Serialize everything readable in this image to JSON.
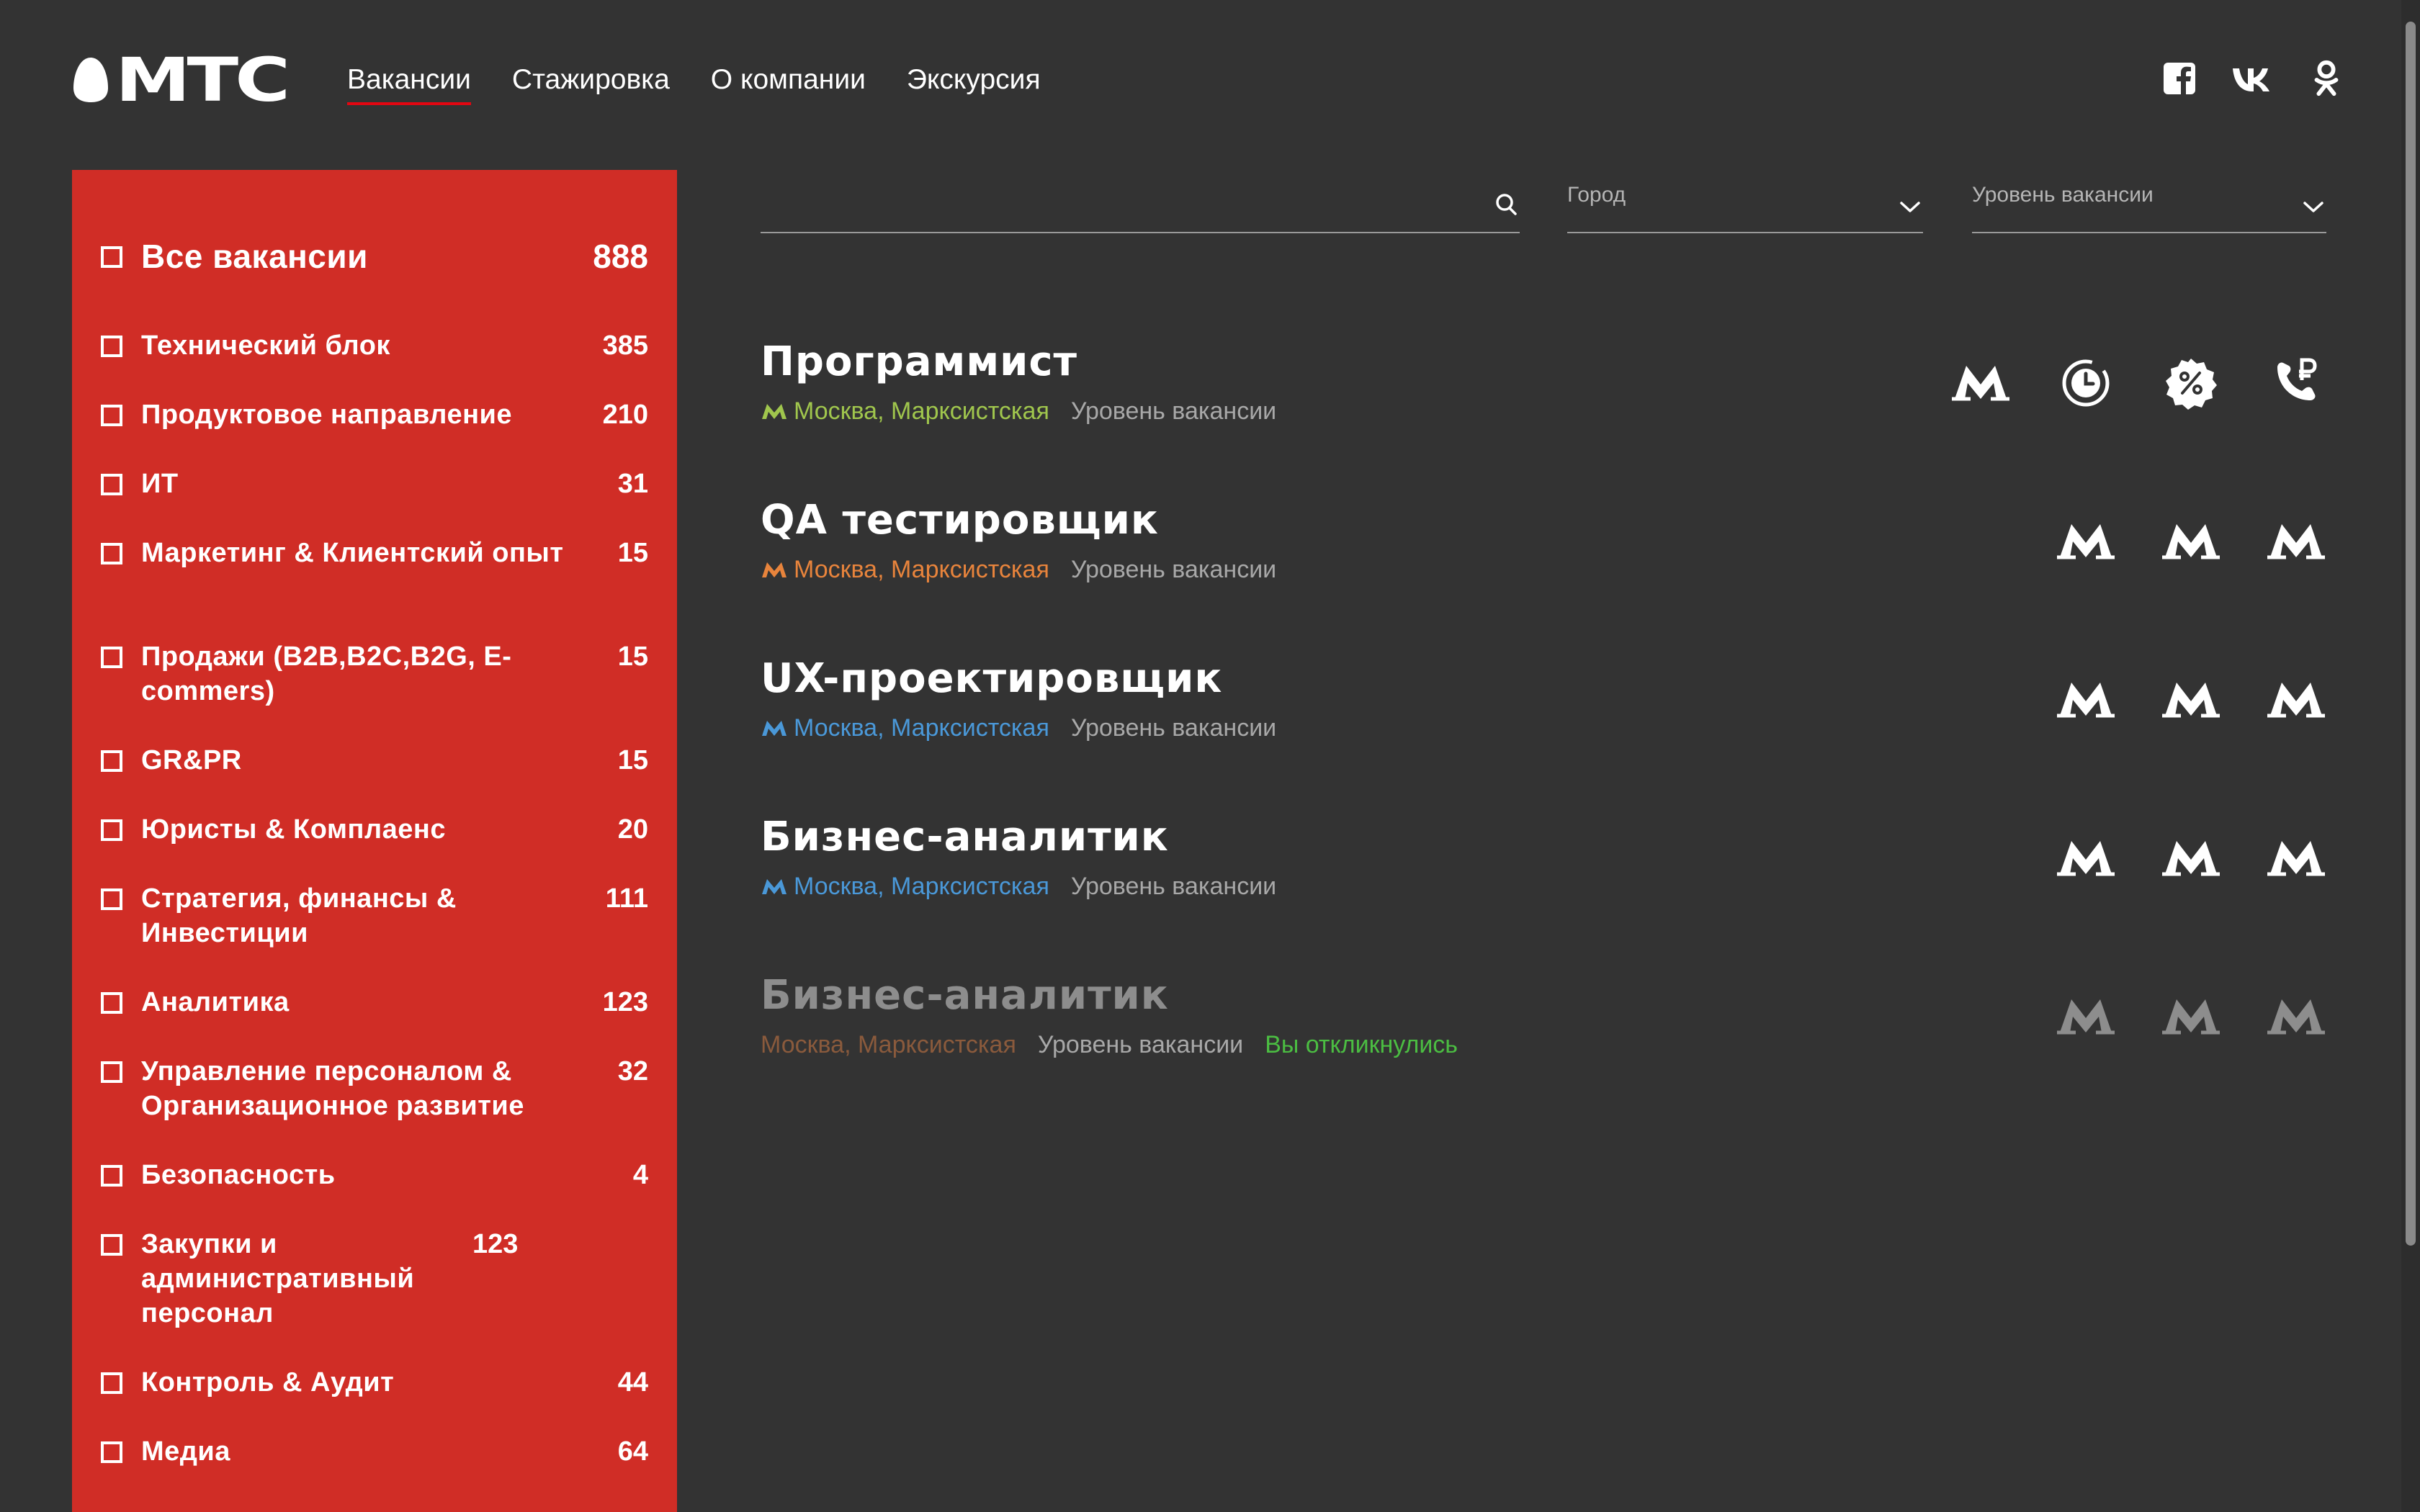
{
  "header": {
    "logo_text": "МТС",
    "nav": [
      {
        "label": "Вакансии",
        "active": true
      },
      {
        "label": "Стажировка",
        "active": false
      },
      {
        "label": "О компании",
        "active": false
      },
      {
        "label": "Экскурсия",
        "active": false
      }
    ],
    "social": [
      "facebook-icon",
      "vk-icon",
      "odnoklassniki-icon"
    ]
  },
  "sidebar": {
    "categories": [
      {
        "label": "Все вакансии",
        "count": "888"
      },
      {
        "label": "Технический блок",
        "count": "385"
      },
      {
        "label": "Продуктовое направление",
        "count": "210"
      },
      {
        "label": "ИТ",
        "count": "31"
      },
      {
        "label": "Маркетинг & Клиентский опыт",
        "count": "15"
      },
      {
        "label": "Продажи (B2B,B2C,B2G, E-commers)",
        "count": "15"
      },
      {
        "label": "GR&PR",
        "count": "15"
      },
      {
        "label": "Юристы & Комплаенс",
        "count": "20"
      },
      {
        "label": "Стратегия, финансы & Инвестиции",
        "count": "111"
      },
      {
        "label": "Аналитика",
        "count": "123"
      },
      {
        "label": "Управление персоналом & Организационное развитие",
        "count": "32"
      },
      {
        "label": "Безопасность",
        "count": "4"
      },
      {
        "label": "Закупки и административный персонал",
        "count": "123"
      },
      {
        "label": "Контроль & Аудит",
        "count": "44"
      },
      {
        "label": "Медиа",
        "count": "64"
      }
    ]
  },
  "filters": {
    "search": {
      "value": "",
      "placeholder": ""
    },
    "city": {
      "placeholder": "Город"
    },
    "level": {
      "placeholder": "Уровень вакансии"
    }
  },
  "vacancies": [
    {
      "title": "Программист",
      "location": "Москва, Марксистская",
      "metro_color": "#a0c64d",
      "level": "Уровень вакансии",
      "status": "",
      "icons": [
        "metro-icon",
        "schedule-icon",
        "discount-icon",
        "phone-payment-icon"
      ]
    },
    {
      "title": "QA тестировщик",
      "location": "Москва, Марксистская",
      "metro_color": "#e8843c",
      "level": "Уровень вакансии",
      "status": "",
      "icons": [
        "metro-icon",
        "metro-icon",
        "metro-icon"
      ]
    },
    {
      "title": "UX-проектировщик",
      "location": "Москва, Марксистская",
      "metro_color": "#4a98d8",
      "level": "Уровень вакансии",
      "status": "",
      "icons": [
        "metro-icon",
        "metro-icon",
        "metro-icon"
      ]
    },
    {
      "title": "Бизнес-аналитик",
      "location": "Москва, Марксистская",
      "metro_color": "#4a98d8",
      "level": "Уровень вакансии",
      "status": "",
      "icons": [
        "metro-icon",
        "metro-icon",
        "metro-icon"
      ]
    },
    {
      "title": "Бизнес-аналитик",
      "location": "Москва, Марксистская",
      "metro_color": "#8a5a3c",
      "level": "Уровень вакансии",
      "status": "Вы откликнулись",
      "icons": [
        "metro-icon",
        "metro-icon",
        "metro-icon"
      ]
    }
  ],
  "colors": {
    "background": "#333333",
    "sidebar": "#d02d26",
    "accent": "#e30611",
    "responded": "#4bbd42"
  }
}
